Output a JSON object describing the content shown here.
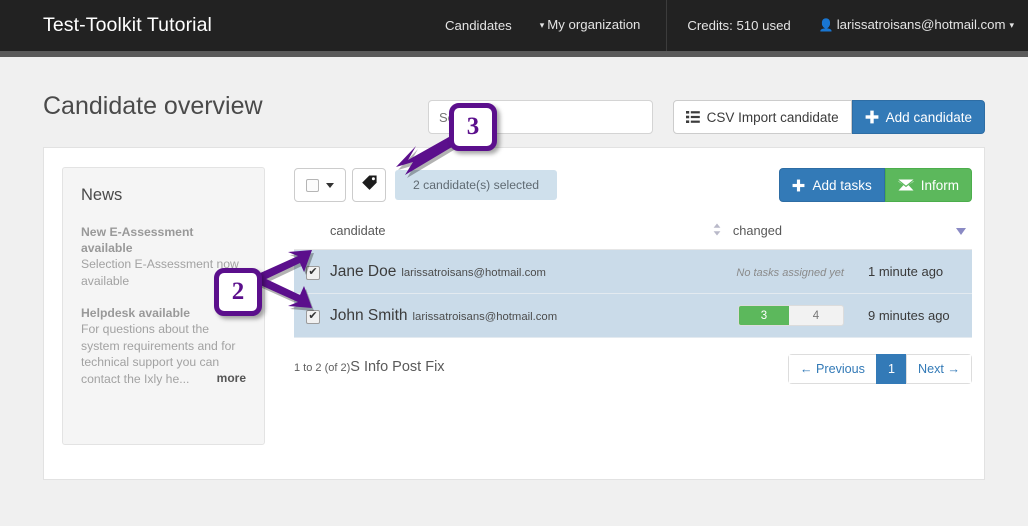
{
  "navbar": {
    "brand": "Test-Toolkit Tutorial",
    "links": [
      {
        "label": "Candidates",
        "caret": false
      },
      {
        "label": "My organization",
        "caret": true
      }
    ],
    "credits": "Credits: 510 used",
    "user": "larissatroisans@hotmail.com",
    "user_icon": "person-icon",
    "caret_icon": "caret-down-icon",
    "bg_color": "#222222"
  },
  "page": {
    "title": "Candidate overview",
    "search_placeholder": "Search",
    "search_value": "",
    "import_button": "CSV Import candidate",
    "import_icon": "list-icon",
    "add_button": "Add candidate",
    "add_icon": "plus-icon"
  },
  "news": {
    "title": "News",
    "items": [
      {
        "heading": "New E-Assessment available",
        "body": "Selection E-Assessment now available"
      },
      {
        "heading": "Helpdesk available",
        "body": "For questions about the system requirements and for technical support you can contact the Ixly he..."
      }
    ],
    "more_label": "more"
  },
  "toolbar": {
    "select_all_icon": "checkbox-icon",
    "select_all_caret": "caret-down-icon",
    "tag_icon": "tag-icon",
    "selection_text": "2 candidate(s) selected",
    "add_tasks_label": "Add tasks",
    "add_tasks_icon": "plus-icon",
    "inform_label": "Inform",
    "inform_icon": "envelope-icon",
    "primary_color": "#337ab7",
    "success_color": "#5cb85c"
  },
  "table": {
    "columns": {
      "candidate": "candidate",
      "changed": "changed",
      "sort_icon": "sort-updown-icon",
      "menu_caret_icon": "caret-down-icon"
    },
    "rows": [
      {
        "checked": true,
        "check_glyph": "✔",
        "name": "Jane Doe",
        "email": "larissatroisans@hotmail.com",
        "task_status": "No tasks assigned yet",
        "progress": null,
        "changed": "1 minute ago"
      },
      {
        "checked": true,
        "check_glyph": "✔",
        "name": "John Smith",
        "email": "larissatroisans@hotmail.com",
        "task_status": "",
        "progress": {
          "done": "3",
          "total": "4"
        },
        "changed": "9 minutes ago"
      }
    ],
    "row_bg_color": "#cadbe9"
  },
  "footer": {
    "info_small": "1 to 2 (of 2)",
    "info_big": "S Info Post Fix",
    "pager": {
      "previous": "← Previous",
      "page": "1",
      "next": "Next →"
    }
  },
  "annotations": [
    {
      "id": "annotation-3",
      "label": "3"
    },
    {
      "id": "annotation-2",
      "label": "2"
    }
  ]
}
